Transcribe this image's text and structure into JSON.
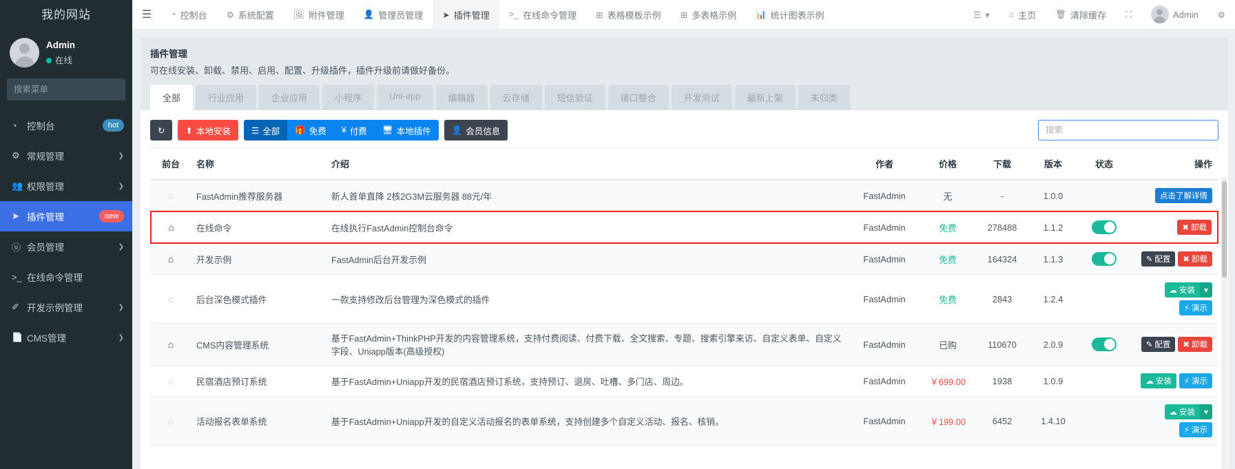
{
  "sidebar": {
    "brand": "我的网站",
    "user": {
      "name": "Admin",
      "status": "在线"
    },
    "search_placeholder": "搜索菜单",
    "items": [
      {
        "label": "控制台",
        "icon": "dashboard-icon",
        "badge": "hot",
        "badge_type": "hot",
        "caret": "",
        "active": false
      },
      {
        "label": "常规管理",
        "icon": "gears-icon",
        "badge": "",
        "caret": "❯",
        "active": false
      },
      {
        "label": "权限管理",
        "icon": "users-icon",
        "badge": "",
        "caret": "❯",
        "active": false
      },
      {
        "label": "插件管理",
        "icon": "rocket-icon",
        "badge": "new",
        "badge_type": "new",
        "caret": "",
        "active": true
      },
      {
        "label": "会员管理",
        "icon": "user-circle-icon",
        "badge": "",
        "caret": "❯",
        "active": false
      },
      {
        "label": "在线命令管理",
        "icon": "terminal-icon",
        "badge": "",
        "caret": "",
        "active": false
      },
      {
        "label": "开发示例管理",
        "icon": "magic-icon",
        "badge": "",
        "caret": "❯",
        "active": false
      },
      {
        "label": "CMS管理",
        "icon": "file-icon",
        "badge": "",
        "caret": "❯",
        "active": false
      }
    ]
  },
  "topnav": {
    "hamburger": "☰",
    "items": [
      {
        "label": "控制台",
        "icon": "dashboard-icon",
        "active": false
      },
      {
        "label": "系统配置",
        "icon": "gear-icon",
        "active": false
      },
      {
        "label": "附件管理",
        "icon": "image-icon",
        "active": false
      },
      {
        "label": "管理员管理",
        "icon": "user-icon",
        "active": false
      },
      {
        "label": "插件管理",
        "icon": "rocket-icon",
        "active": true
      },
      {
        "label": "在线命令管理",
        "icon": "terminal-icon",
        "active": false
      },
      {
        "label": "表格模板示例",
        "icon": "table-icon",
        "active": false
      },
      {
        "label": "多表格示例",
        "icon": "table-icon",
        "active": false
      },
      {
        "label": "统计图表示例",
        "icon": "chart-icon",
        "active": false
      }
    ],
    "right": [
      {
        "label": "",
        "icon": "list-menu-icon",
        "caret": "▾"
      },
      {
        "label": "主页",
        "icon": "home-icon"
      },
      {
        "label": "清除缓存",
        "icon": "trash-icon"
      },
      {
        "label": "",
        "icon": "fullscreen-icon"
      },
      {
        "label": "Admin",
        "icon": "avatar"
      },
      {
        "label": "",
        "icon": "gears-settings-icon"
      }
    ]
  },
  "panel": {
    "title": "插件管理",
    "desc": "可在线安装、卸载、禁用、启用、配置、升级插件，插件升级前请做好备份。",
    "tabs": [
      {
        "label": "全部",
        "active": true
      },
      {
        "label": "行业应用",
        "active": false
      },
      {
        "label": "企业应用",
        "active": false
      },
      {
        "label": "小程序",
        "active": false
      },
      {
        "label": "Uni-app",
        "active": false
      },
      {
        "label": "编辑器",
        "active": false
      },
      {
        "label": "云存储",
        "active": false
      },
      {
        "label": "短信验证",
        "active": false
      },
      {
        "label": "接口整合",
        "active": false
      },
      {
        "label": "开发测试",
        "active": false
      },
      {
        "label": "最新上架",
        "active": false
      },
      {
        "label": "未归类",
        "active": false
      }
    ]
  },
  "toolbar": {
    "refresh_icon": "refresh-icon",
    "local_install": "本地安装",
    "local_install_icon": "upload-icon",
    "filter_all": "全部",
    "filter_all_icon": "list-icon",
    "filter_free": "免费",
    "filter_free_icon": "gift-icon",
    "filter_paid": "付费",
    "filter_paid_icon": "¥",
    "filter_local": "本地插件",
    "filter_local_icon": "desktop-icon",
    "member_info": "会员信息",
    "member_info_icon": "user-icon",
    "search_placeholder": "搜索"
  },
  "table": {
    "columns": [
      "前台",
      "名称",
      "介绍",
      "作者",
      "价格",
      "下载",
      "版本",
      "状态",
      "操作"
    ],
    "rows": [
      {
        "front": "home-icon",
        "front_on": false,
        "name": "FastAdmin推荐服务器",
        "intro": "新人首单直降 2核2G3M云服务器 88元/年",
        "author": "FastAdmin",
        "price": "无",
        "price_style": "normal",
        "downloads": "-",
        "version": "1.0.0",
        "enabled": null,
        "actions": [
          {
            "label": "点击了解详情",
            "style": "sb-blue",
            "icon": ""
          }
        ],
        "highlight": false
      },
      {
        "front": "home-icon",
        "front_on": true,
        "name": "在线命令",
        "intro": "在线执行FastAdmin控制台命令",
        "author": "FastAdmin",
        "price": "免费",
        "price_style": "free",
        "downloads": "278488",
        "version": "1.1.2",
        "enabled": true,
        "actions": [
          {
            "label": "卸载",
            "style": "sb-red",
            "icon": "✖"
          }
        ],
        "highlight": true
      },
      {
        "front": "home-icon",
        "front_on": true,
        "name": "开发示例",
        "intro": "FastAdmin后台开发示例",
        "author": "FastAdmin",
        "price": "免费",
        "price_style": "free",
        "downloads": "164324",
        "version": "1.1.3",
        "enabled": true,
        "actions": [
          {
            "label": "配置",
            "style": "sb-dark",
            "icon": "✎"
          },
          {
            "label": "卸载",
            "style": "sb-red",
            "icon": "✖"
          }
        ],
        "highlight": false
      },
      {
        "front": "home-icon",
        "front_on": false,
        "name": "后台深色模式插件",
        "intro": "一款支持修改后台管理为深色模式的插件",
        "author": "FastAdmin",
        "price": "免费",
        "price_style": "free",
        "downloads": "2843",
        "version": "1.2.4",
        "enabled": null,
        "actions": [
          {
            "label": "安装",
            "style": "sb-green",
            "icon": "☁",
            "caret": true
          },
          {
            "label": "演示",
            "style": "sb-cyan",
            "icon": "⚡"
          }
        ],
        "stacked": true,
        "highlight": false
      },
      {
        "front": "home-icon",
        "front_on": true,
        "name": "CMS内容管理系统",
        "intro": "基于FastAdmin+ThinkPHP开发的内容管理系统，支持付费阅读、付费下载、全文搜索、专题、搜索引擎来访、自定义表单、自定义字段、Uniapp版本(高级授权)",
        "author": "FastAdmin",
        "price": "已购",
        "price_style": "bought",
        "downloads": "110670",
        "version": "2.0.9",
        "enabled": true,
        "actions": [
          {
            "label": "配置",
            "style": "sb-dark",
            "icon": "✎"
          },
          {
            "label": "卸载",
            "style": "sb-red",
            "icon": "✖"
          }
        ],
        "highlight": false
      },
      {
        "front": "home-icon",
        "front_on": false,
        "name": "民宿酒店预订系统",
        "intro": "基于FastAdmin+Uniapp开发的民宿酒店预订系统，支持预订、退房、吐槽、多门店、周边。",
        "author": "FastAdmin",
        "price": "￥699.00",
        "price_style": "paid",
        "downloads": "1938",
        "version": "1.0.9",
        "enabled": null,
        "actions": [
          {
            "label": "安装",
            "style": "sb-green",
            "icon": "☁"
          },
          {
            "label": "演示",
            "style": "sb-cyan",
            "icon": "⚡"
          }
        ],
        "highlight": false
      },
      {
        "front": "home-icon",
        "front_on": false,
        "name": "活动报名表单系统",
        "intro": "基于FastAdmin+Uniapp开发的自定义活动报名的表单系统，支持创建多个自定义活动、报名、核销。",
        "author": "FastAdmin",
        "price": "￥199.00",
        "price_style": "paid",
        "downloads": "6452",
        "version": "1.4.10",
        "enabled": null,
        "actions": [
          {
            "label": "安装",
            "style": "sb-green",
            "icon": "☁",
            "caret": true
          },
          {
            "label": "演示",
            "style": "sb-cyan",
            "icon": "⚡"
          }
        ],
        "stacked": true,
        "highlight": false
      }
    ]
  },
  "colors": {
    "sidebar_bg": "#222d32",
    "accent_blue": "#3c6fe4",
    "badge_hot": "#3c8dbc",
    "badge_new": "#f75f5f",
    "free_green": "#19b99a",
    "price_red": "#f64a42",
    "highlight_border": "#f2231b"
  }
}
